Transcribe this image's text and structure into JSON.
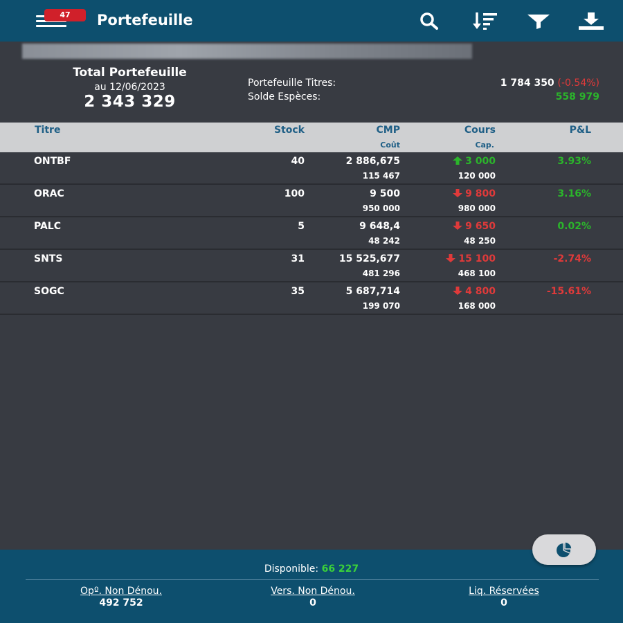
{
  "header": {
    "badge": "47",
    "title": "Portefeuille",
    "icons": [
      "menu-icon",
      "search-icon",
      "sort-icon",
      "filter-icon",
      "download-icon"
    ]
  },
  "summary": {
    "title": "Total Portefeuille",
    "date": "au 12/06/2023",
    "total": "2 343 329",
    "titres_label": "Portefeuille Titres:",
    "titres_value": "1 784 350",
    "titres_change": "(-0.54%)",
    "especes_label": "Solde Espèces:",
    "especes_value": "558 979"
  },
  "table": {
    "headers": {
      "titre": "Titre",
      "stock": "Stock",
      "cmp": "CMP",
      "cout": "Coût",
      "cours": "Cours",
      "cap": "Cap.",
      "pl": "P&L"
    },
    "rows": [
      {
        "titre": "ONTBF",
        "stock": "40",
        "cmp": "2 886,675",
        "cout": "115 467",
        "cours": "3 000",
        "cap": "120 000",
        "pl": "3.93%",
        "trend": "up"
      },
      {
        "titre": "ORAC",
        "stock": "100",
        "cmp": "9 500",
        "cout": "950 000",
        "cours": "9 800",
        "cap": "980 000",
        "pl": "3.16%",
        "trend": "down"
      },
      {
        "titre": "PALC",
        "stock": "5",
        "cmp": "9 648,4",
        "cout": "48 242",
        "cours": "9 650",
        "cap": "48 250",
        "pl": "0.02%",
        "trend": "down"
      },
      {
        "titre": "SNTS",
        "stock": "31",
        "cmp": "15 525,677",
        "cout": "481 296",
        "cours": "15 100",
        "cap": "468 100",
        "pl": "-2.74%",
        "trend": "down"
      },
      {
        "titre": "SOGC",
        "stock": "35",
        "cmp": "5 687,714",
        "cout": "199 070",
        "cours": "4 800",
        "cap": "168 000",
        "pl": "-15.61%",
        "trend": "down"
      }
    ]
  },
  "footer": {
    "disponible_label": "Disponible:",
    "disponible_value": "66 227",
    "op_label": "Opº. Non Dénou.",
    "op_value": "492 752",
    "vers_label": "Vers. Non Dénou.",
    "vers_value": "0",
    "liq_label": "Liq. Réservées",
    "liq_value": "0"
  },
  "colors": {
    "header_bg": "#0d4f6e",
    "body_bg": "#383b42",
    "table_header_bg": "#cfd0d2",
    "positive": "#2bb52b",
    "negative": "#e03a3a",
    "badge": "#d0202a"
  }
}
